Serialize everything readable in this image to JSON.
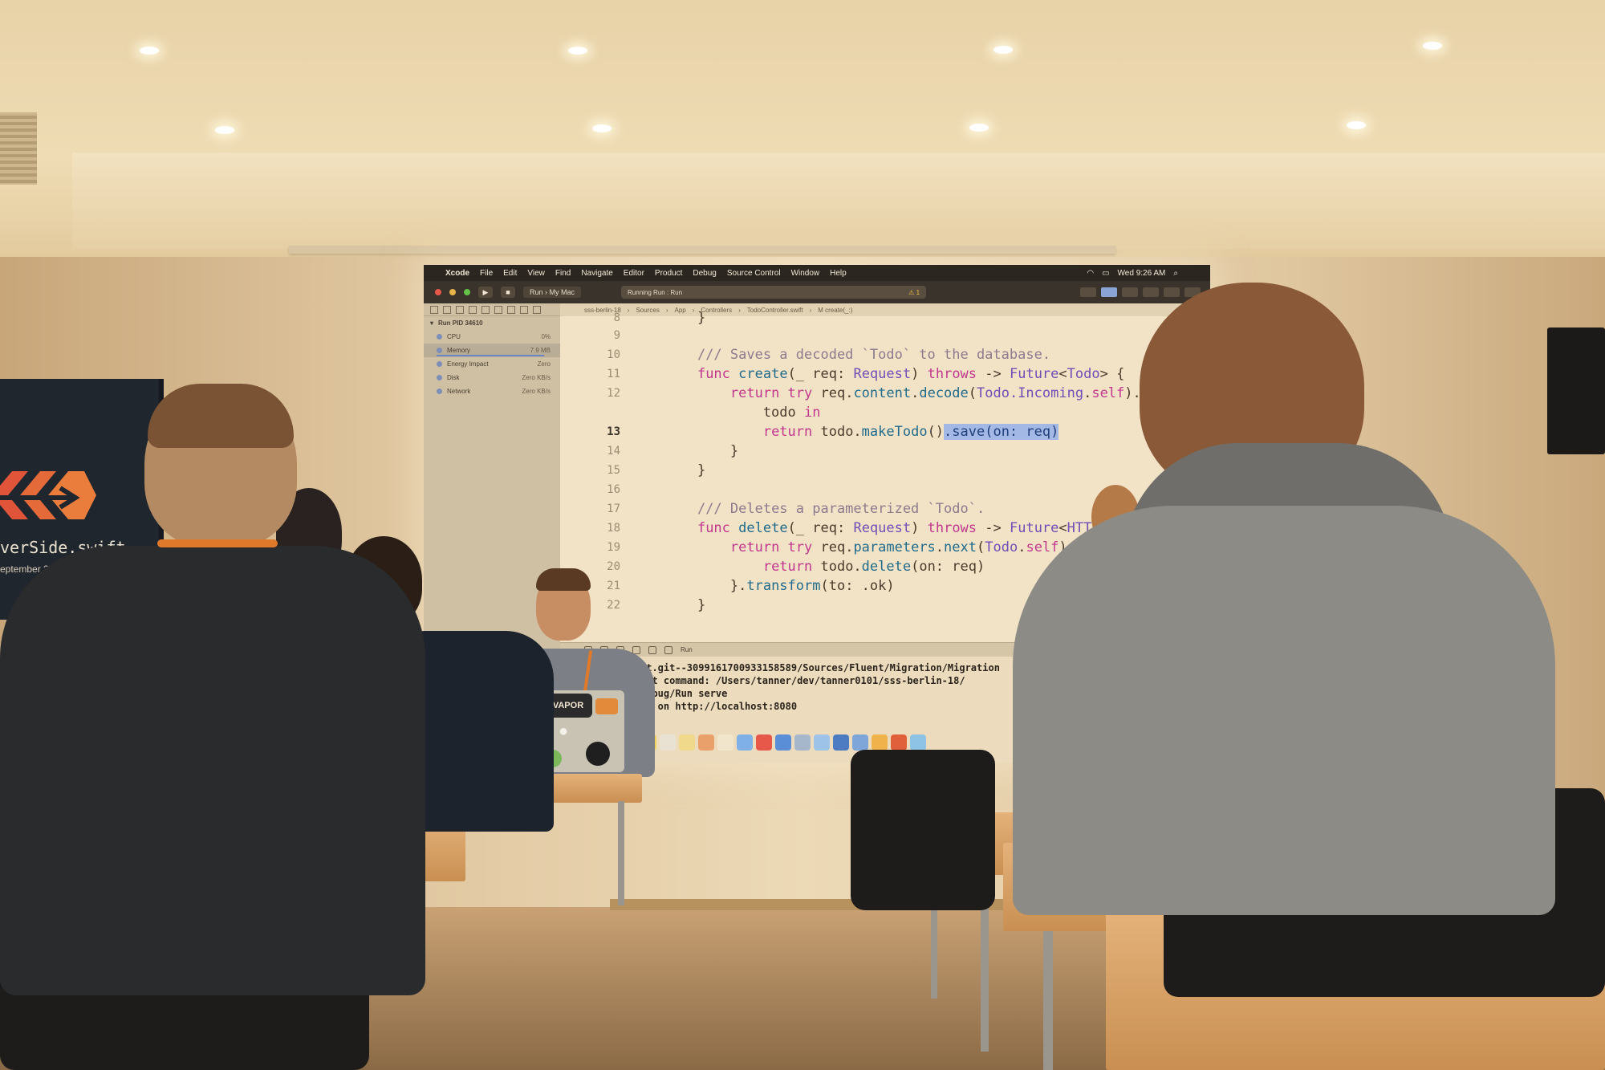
{
  "banner": {
    "logo_icon": "swift-bird-chevrons-icon",
    "title": "verSide.swift",
    "subtitle": "eptember 2018, Berlin, Germa"
  },
  "menubar": {
    "apple_glyph": "",
    "app_name": "Xcode",
    "items": [
      "File",
      "Edit",
      "View",
      "Find",
      "Navigate",
      "Editor",
      "Product",
      "Debug",
      "Source Control",
      "Window",
      "Help"
    ],
    "clock": "Wed 9:26 AM"
  },
  "toolbar": {
    "scheme": "Run",
    "destination": "My Mac",
    "status": "Running Run : Run",
    "warning_glyph": "⚠ 1"
  },
  "navigator": {
    "run_label": "Run PID 34610",
    "gauges": [
      {
        "label": "CPU",
        "value": "0%"
      },
      {
        "label": "Memory",
        "value": "7.9 MB"
      },
      {
        "label": "Energy Impact",
        "value": "Zero"
      },
      {
        "label": "Disk",
        "value": "Zero KB/s"
      },
      {
        "label": "Network",
        "value": "Zero KB/s"
      }
    ]
  },
  "breadcrumb": [
    "sss-berlin-18",
    "Sources",
    "App",
    "Controllers",
    "TodoController.swift",
    "M create(_:)"
  ],
  "editor": {
    "line_numbers": [
      "8",
      "9",
      "10",
      "11",
      "12",
      "",
      "13",
      "14",
      "15",
      "16",
      "17",
      "18",
      "19",
      "20",
      "21",
      "22"
    ],
    "current_line": "13"
  },
  "console": {
    "run_label": "Run",
    "lines": [
      "nt.git--3099161700933158589/Sources/Fluent/Migration/Migration",
      "ult command: /Users/tanner/dev/tanner0101/sss-berlin-18/",
      "Debug/Run serve",
      "ng on http://localhost:8080"
    ]
  },
  "laptop": {
    "sticker_text": "VAPOR"
  },
  "colors": {
    "keyword": "#c2378f",
    "type": "#6f4eb6",
    "comment": "#8c7a8e",
    "selection": "#a4b8e6",
    "lanyard": "#e07a2a"
  }
}
